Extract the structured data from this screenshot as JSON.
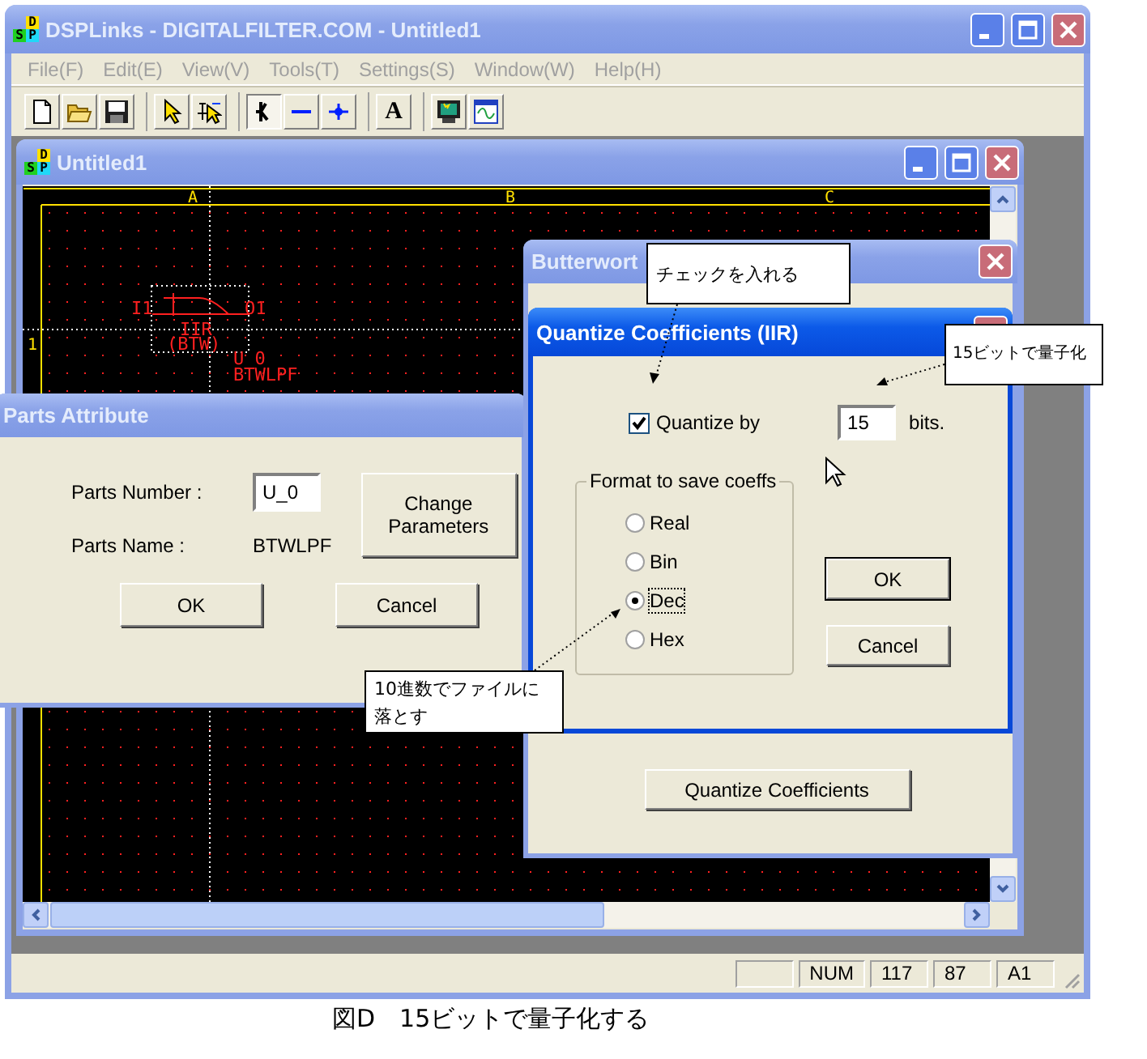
{
  "main_window": {
    "title": "DSPLinks - DIGITALFILTER.COM - Untitled1",
    "icon_letters": [
      "D",
      "S",
      "P"
    ]
  },
  "menu": [
    "File(F)",
    "Edit(E)",
    "View(V)",
    "Tools(T)",
    "Settings(S)",
    "Window(W)",
    "Help(H)"
  ],
  "toolbar": [
    {
      "kind": "icon",
      "pressed": false
    },
    {
      "kind": "icon",
      "pressed": false
    },
    {
      "kind": "icon",
      "pressed": false
    },
    {
      "kind": "icon",
      "pressed": false
    },
    {
      "kind": "icon",
      "pressed": false
    },
    {
      "kind": "icon",
      "pressed": true
    },
    {
      "kind": "icon",
      "pressed": false
    },
    {
      "kind": "icon",
      "pressed": false
    },
    {
      "kind": "text",
      "label": "A",
      "pressed": false
    },
    {
      "kind": "icon",
      "pressed": false
    },
    {
      "kind": "icon",
      "pressed": false
    }
  ],
  "document_window": {
    "title": "Untitled1",
    "icon_letters": [
      "D",
      "S",
      "P"
    ]
  },
  "schematic": {
    "columns": [
      "A",
      "B",
      "C"
    ],
    "rows": [
      "1"
    ],
    "part": {
      "input": "I1",
      "output": "O1",
      "type": "IIR",
      "subtype": "(BTW)",
      "number": "U_0",
      "name": "BTWLPF"
    }
  },
  "parts_attribute": {
    "title": "Parts Attribute",
    "number_label": "Parts Number :",
    "number_value": "U_0",
    "name_label": "Parts Name :",
    "name_value": "BTWLPF",
    "change_button": "Change Parameters",
    "ok": "OK",
    "cancel": "Cancel"
  },
  "butterworth": {
    "title": "Butterwort",
    "button": "Quantize Coefficients"
  },
  "quantize": {
    "title": "Quantize Coefficients (IIR)",
    "checkbox": {
      "label": "Quantize by",
      "checked": true
    },
    "bits": "15",
    "bits_unit": "bits.",
    "group": {
      "title": "Format to save coeffs",
      "options": [
        {
          "label": "Real",
          "selected": false
        },
        {
          "label": "Bin",
          "selected": false
        },
        {
          "label": "Dec",
          "selected": true
        },
        {
          "label": "Hex",
          "selected": false
        }
      ]
    },
    "ok": "OK",
    "cancel": "Cancel"
  },
  "callouts": [
    {
      "text": "チェックを入れる"
    },
    {
      "text": "15ビットで量子化"
    },
    {
      "text": "10進数でファイルに落とす"
    }
  ],
  "status_bar": [
    "NUM",
    "117",
    "87",
    "A1"
  ],
  "caption": "図D　15ビットで量子化する"
}
